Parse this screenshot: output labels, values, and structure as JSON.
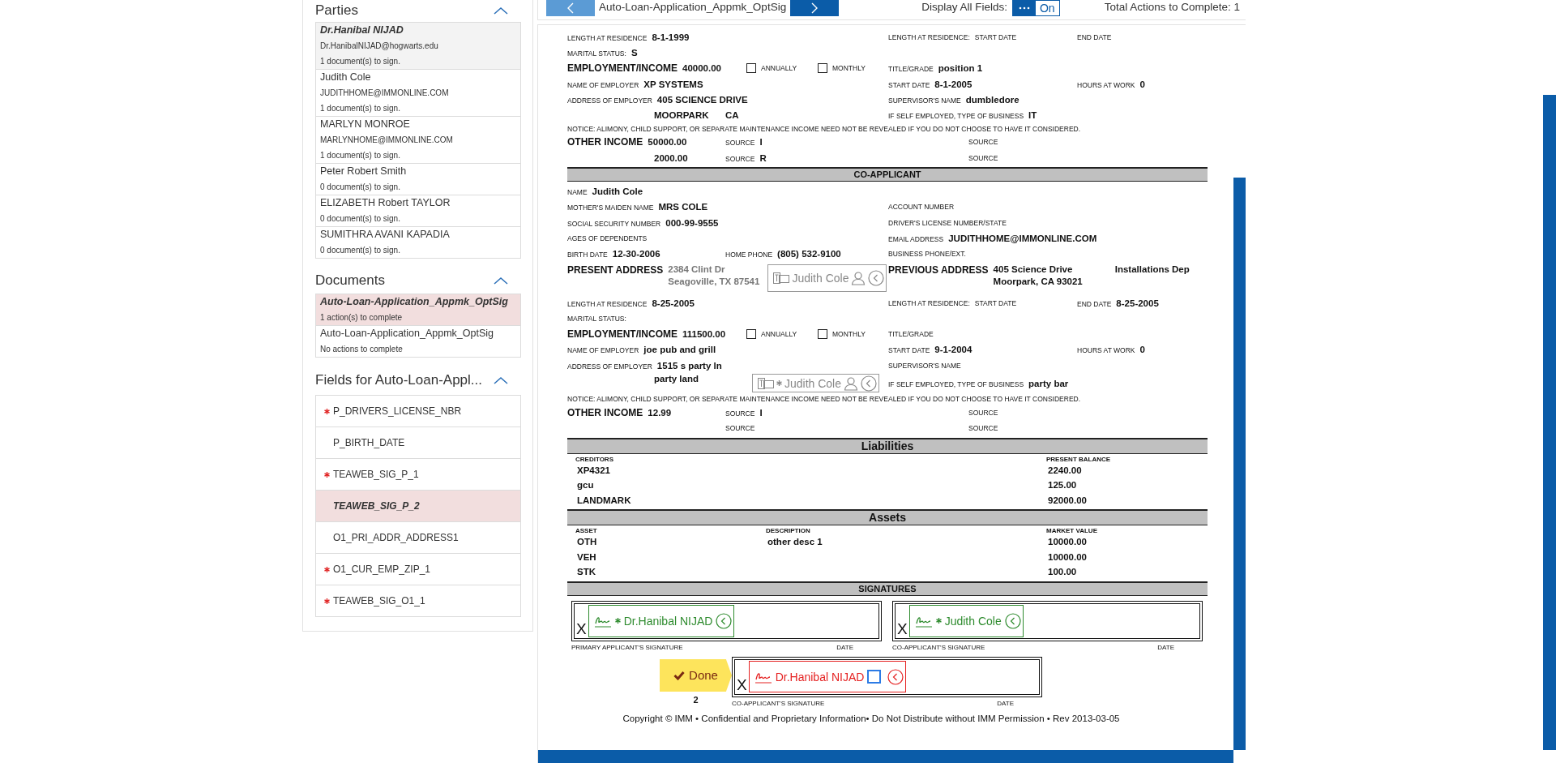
{
  "parties": {
    "title": "Parties",
    "expanded": true,
    "items": [
      {
        "name": "Dr.Hanibal NIJAD",
        "email": "Dr.HanibalNIJAD@hogwarts.edu",
        "status": "1 document(s) to sign.",
        "selected": true
      },
      {
        "name": "Judith Cole",
        "email": "JUDITHHOME@IMMONLINE.COM",
        "status": "1 document(s) to sign.",
        "selected": false
      },
      {
        "name": "MARLYN MONROE",
        "email": "MARLYNHOME@IMMONLINE.COM",
        "status": "1 document(s) to sign.",
        "selected": false
      },
      {
        "name": "Peter Robert Smith",
        "status": "0 document(s) to sign.",
        "selected": false
      },
      {
        "name": "ELIZABETH Robert TAYLOR",
        "status": "0 document(s) to sign.",
        "selected": false
      },
      {
        "name": "SUMITHRA AVANI KAPADIA",
        "status": "0 document(s) to sign.",
        "selected": false
      }
    ]
  },
  "documents": {
    "title": "Documents",
    "expanded": true,
    "items": [
      {
        "name": "Auto-Loan-Application_Appmk_OptSig",
        "status": "1 action(s) to complete",
        "selected": true
      },
      {
        "name": "Auto-Loan-Application_Appmk_OptSig",
        "status": "No actions to complete",
        "selected": false
      }
    ]
  },
  "fields": {
    "title": "Fields for Auto-Loan-Appl...",
    "expanded": true,
    "items": [
      {
        "name": "P_DRIVERS_LICENSE_NBR",
        "required": true,
        "selected": false
      },
      {
        "name": "P_BIRTH_DATE",
        "required": false,
        "selected": false
      },
      {
        "name": "TEAWEB_SIG_P_1",
        "required": true,
        "selected": false
      },
      {
        "name": "TEAWEB_SIG_P_2",
        "required": false,
        "selected": true
      },
      {
        "name": "O1_PRI_ADDR_ADDRESS1",
        "required": false,
        "selected": false
      },
      {
        "name": "O1_CUR_EMP_ZIP_1",
        "required": true,
        "selected": false
      },
      {
        "name": "TEAWEB_SIG_O1_1",
        "required": true,
        "selected": false
      }
    ]
  },
  "toolbar": {
    "document_title": "Auto-Loan-Application_Appmk_OptSig",
    "display_all_fields": {
      "label": "Display All Fields:",
      "on": true,
      "state_label": "On"
    },
    "total_actions": "Total Actions to Complete: 1"
  },
  "document": {
    "blocks": [
      {
        "kind": "row",
        "left": [
          {
            "kind": "field",
            "label": "LENGTH AT RESIDENCE",
            "value": "8-1-1999"
          }
        ],
        "right": [
          {
            "kind": "field",
            "label": "LENGTH AT RESIDENCE:",
            "sublabel": "START DATE"
          },
          {
            "kind": "field",
            "label": "END DATE"
          }
        ]
      },
      {
        "kind": "row",
        "left": [
          {
            "kind": "field",
            "label": "MARITAL STATUS:",
            "value": "S"
          }
        ]
      },
      {
        "kind": "row",
        "left": [
          {
            "kind": "heading",
            "label": "EMPLOYMENT/INCOME",
            "value": "40000.00"
          },
          {
            "kind": "checkbox",
            "label": "ANNUALLY",
            "checked": false
          },
          {
            "kind": "checkbox",
            "label": "MONTHLY",
            "checked": false
          }
        ],
        "right": [
          {
            "kind": "field",
            "label": "TITLE/GRADE",
            "value": "position 1"
          }
        ]
      },
      {
        "kind": "row",
        "left": [
          {
            "kind": "field",
            "label": "NAME OF EMPLOYER",
            "value": "XP SYSTEMS"
          }
        ],
        "right": [
          {
            "kind": "field",
            "label": "START DATE",
            "value": "8-1-2005"
          },
          {
            "kind": "field",
            "label": "HOURS AT WORK",
            "value": "0"
          }
        ]
      },
      {
        "kind": "row",
        "left": [
          {
            "kind": "field",
            "label": "ADDRESS OF EMPLOYER",
            "value": "405 SCIENCE DRIVE"
          }
        ],
        "right": [
          {
            "kind": "field",
            "label": "SUPERVISOR'S NAME",
            "value": "dumbledore"
          }
        ]
      },
      {
        "kind": "row",
        "left": [
          {
            "kind": "continuation",
            "value": "MOORPARK"
          },
          {
            "kind": "field",
            "value": "CA"
          }
        ],
        "right": [
          {
            "kind": "field",
            "label": "IF SELF EMPLOYED, TYPE OF BUSINESS",
            "value": "IT"
          }
        ]
      },
      {
        "kind": "notice",
        "text": "NOTICE: ALIMONY, CHILD SUPPORT, OR SEPARATE MAINTENANCE INCOME NEED NOT BE REVEALED IF YOU DO NOT CHOOSE TO HAVE IT CONSIDERED."
      },
      {
        "kind": "row",
        "left": [
          {
            "kind": "heading",
            "label": "OTHER INCOME",
            "value": "50000.00"
          },
          {
            "kind": "source",
            "label": "SOURCE",
            "value": "I"
          }
        ],
        "right": [
          {
            "kind": "source",
            "label": "SOURCE"
          }
        ]
      },
      {
        "kind": "row",
        "left": [
          {
            "kind": "continuation",
            "value": "2000.00"
          },
          {
            "kind": "source",
            "label": "SOURCE",
            "value": "R"
          }
        ],
        "right": [
          {
            "kind": "source",
            "label": "SOURCE"
          }
        ]
      },
      {
        "kind": "bar",
        "title": "CO-APPLICANT"
      },
      {
        "kind": "row",
        "left": [
          {
            "kind": "field",
            "label": "NAME",
            "value": "Judith Cole"
          }
        ]
      },
      {
        "kind": "row",
        "left": [
          {
            "kind": "field",
            "label": "MOTHER'S MAIDEN NAME",
            "value": "MRS COLE"
          }
        ],
        "right": [
          {
            "kind": "field",
            "label": "ACCOUNT NUMBER"
          }
        ]
      },
      {
        "kind": "row",
        "left": [
          {
            "kind": "field",
            "label": "SOCIAL SECURITY NUMBER",
            "value": "000-99-9555"
          }
        ],
        "right": [
          {
            "kind": "field",
            "label": "DRIVER'S LICENSE NUMBER/STATE"
          }
        ]
      },
      {
        "kind": "row",
        "left": [
          {
            "kind": "field",
            "label": "AGES OF DEPENDENTS"
          }
        ],
        "right": [
          {
            "kind": "field",
            "label": "EMAIL ADDRESS",
            "value": "JUDITHHOME@IMMONLINE.COM"
          }
        ]
      },
      {
        "kind": "row",
        "left": [
          {
            "kind": "field",
            "label": "BIRTH DATE",
            "value": "12-30-2006"
          },
          {
            "kind": "field",
            "label": "HOME PHONE",
            "value": "(805) 532-9100"
          }
        ],
        "right": [
          {
            "kind": "field",
            "label": "BUSINESS PHONE/EXT."
          }
        ]
      },
      {
        "kind": "row",
        "left": [
          {
            "kind": "address",
            "label": "PRESENT ADDRESS",
            "lines": [
              "2384 Clint Dr",
              "Seagoville, TX 87541"
            ],
            "prefilled": true,
            "overlay": {
              "name": "Judith Cole",
              "required": false
            }
          }
        ],
        "right": [
          {
            "kind": "address",
            "label": "PREVIOUS ADDRESS",
            "lines": [
              "405 Science Drive",
              "Moorpark, CA 93021"
            ],
            "prefilled": false
          },
          {
            "kind": "field",
            "value": "Installations Dep"
          }
        ]
      },
      {
        "kind": "row",
        "left": [
          {
            "kind": "field",
            "label": "LENGTH AT RESIDENCE",
            "value": "8-25-2005"
          }
        ],
        "right": [
          {
            "kind": "field",
            "label": "LENGTH AT RESIDENCE:",
            "sublabel": "START DATE"
          },
          {
            "kind": "field",
            "label": "END DATE",
            "value": "8-25-2005"
          }
        ]
      },
      {
        "kind": "row",
        "left": [
          {
            "kind": "field",
            "label": "MARITAL STATUS:"
          }
        ]
      },
      {
        "kind": "row",
        "left": [
          {
            "kind": "heading",
            "label": "EMPLOYMENT/INCOME",
            "value": "111500.00"
          },
          {
            "kind": "checkbox",
            "label": "ANNUALLY",
            "checked": false
          },
          {
            "kind": "checkbox",
            "label": "MONTHLY",
            "checked": false
          }
        ],
        "right": [
          {
            "kind": "field",
            "label": "TITLE/GRADE"
          }
        ]
      },
      {
        "kind": "row",
        "left": [
          {
            "kind": "field",
            "label": "NAME OF EMPLOYER",
            "value": "joe pub and grill"
          }
        ],
        "right": [
          {
            "kind": "field",
            "label": "START DATE",
            "value": "9-1-2004"
          },
          {
            "kind": "field",
            "label": "HOURS AT WORK",
            "value": "0"
          }
        ]
      },
      {
        "kind": "row",
        "left": [
          {
            "kind": "field",
            "label": "ADDRESS OF EMPLOYER",
            "value": "1515 s party ln"
          }
        ],
        "right": [
          {
            "kind": "field",
            "label": "SUPERVISOR'S NAME"
          }
        ]
      },
      {
        "kind": "row",
        "left": [
          {
            "kind": "continuation",
            "value": "party land",
            "overlay": {
              "name": "Judith Cole",
              "required": true
            }
          }
        ],
        "right": [
          {
            "kind": "field",
            "label": "IF SELF EMPLOYED, TYPE OF BUSINESS",
            "value": "party bar"
          }
        ]
      },
      {
        "kind": "notice",
        "text": "NOTICE: ALIMONY, CHILD SUPPORT, OR SEPARATE MAINTENANCE INCOME NEED NOT BE REVEALED IF YOU DO NOT CHOOSE TO HAVE IT CONSIDERED."
      },
      {
        "kind": "row",
        "left": [
          {
            "kind": "heading",
            "label": "OTHER INCOME",
            "value": "12.99"
          },
          {
            "kind": "source",
            "label": "SOURCE",
            "value": "I"
          }
        ],
        "right": [
          {
            "kind": "source",
            "label": "SOURCE"
          }
        ]
      },
      {
        "kind": "row",
        "left": [
          {
            "kind": "source",
            "label": "SOURCE"
          }
        ],
        "right": [
          {
            "kind": "source",
            "label": "SOURCE"
          }
        ]
      },
      {
        "kind": "table",
        "title": "Liabilities",
        "columns": [
          "CREDITORS",
          "PRESENT BALANCE"
        ],
        "rows": [
          [
            "XP4321",
            "2240.00"
          ],
          [
            "gcu",
            "125.00"
          ],
          [
            "LANDMARK",
            "92000.00"
          ]
        ]
      },
      {
        "kind": "table",
        "title": "Assets",
        "columns": [
          "ASSET",
          "DESCRIPTION",
          "MARKET VALUE"
        ],
        "rows": [
          [
            "OTH",
            "other desc 1",
            "10000.00"
          ],
          [
            "VEH",
            null,
            "10000.00"
          ],
          [
            "STK",
            null,
            "100.00"
          ]
        ]
      },
      {
        "kind": "signatures",
        "title": "SIGNATURES",
        "boxes": [
          {
            "x_mark": "X",
            "caption": "PRIMARY APPLICANT'S SIGNATURE",
            "date_caption": "DATE",
            "field": {
              "name": "Dr.Hanibal NIJAD",
              "required": true,
              "completed": true
            }
          },
          {
            "x_mark": "X",
            "caption": "CO-APPLICANT'S SIGNATURE",
            "date_caption": "DATE",
            "field": {
              "name": "Judith Cole",
              "required": true,
              "completed": true
            }
          },
          {
            "x_mark": "X",
            "caption": "CO-APPLICANT'S SIGNATURE",
            "date_caption": "DATE",
            "field": {
              "name": "Dr.Hanibal NIJAD",
              "required": false,
              "completed": false,
              "checked": false
            },
            "done_button": {
              "label": "Done",
              "count": "2"
            }
          }
        ]
      }
    ],
    "copyright": "Copyright © IMM • Confidential and Proprietary Information• Do Not Distribute without IMM Permission • Rev 2013-03-05"
  }
}
